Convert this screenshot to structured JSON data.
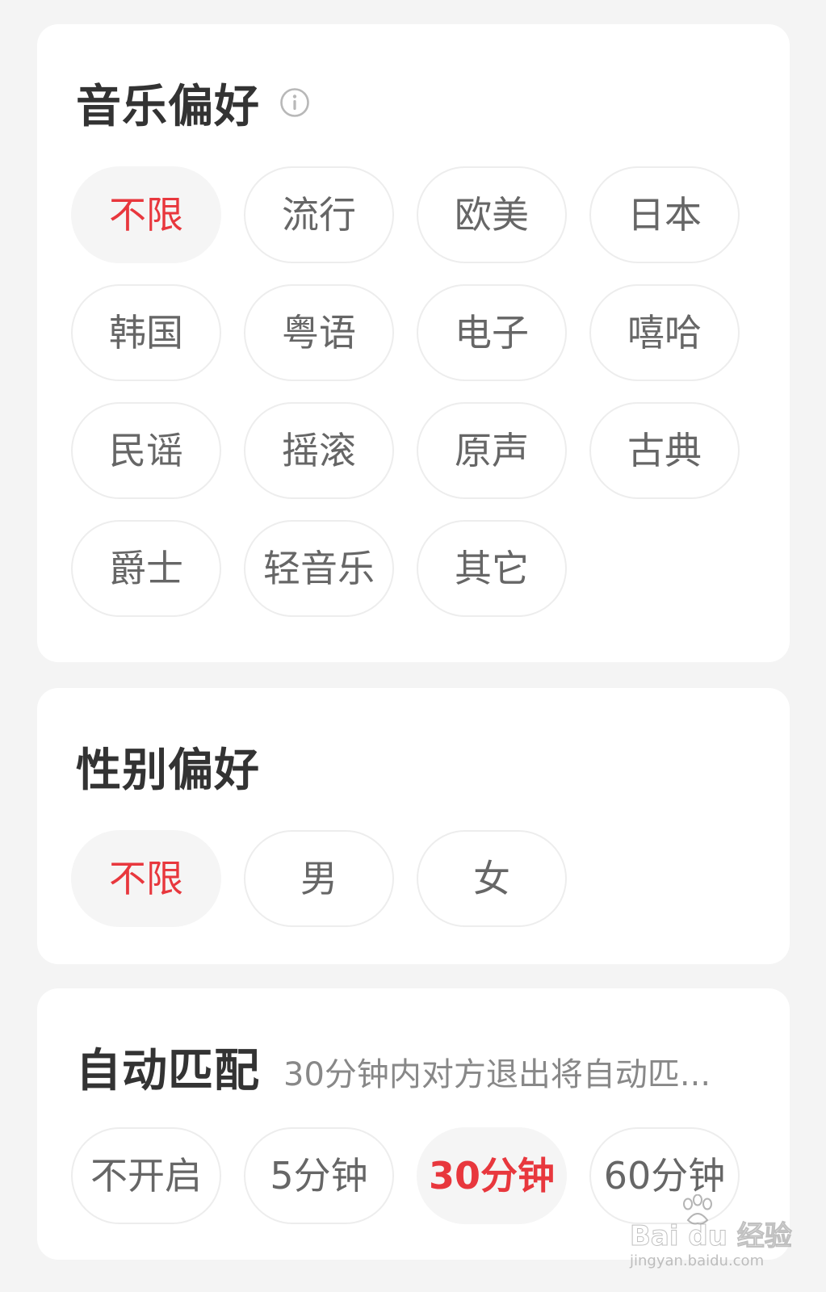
{
  "music": {
    "title": "音乐偏好",
    "info_icon": "info-circle-icon",
    "options": [
      {
        "label": "不限",
        "selected": true
      },
      {
        "label": "流行",
        "selected": false
      },
      {
        "label": "欧美",
        "selected": false
      },
      {
        "label": "日本",
        "selected": false
      },
      {
        "label": "韩国",
        "selected": false
      },
      {
        "label": "粤语",
        "selected": false
      },
      {
        "label": "电子",
        "selected": false
      },
      {
        "label": "嘻哈",
        "selected": false
      },
      {
        "label": "民谣",
        "selected": false
      },
      {
        "label": "摇滚",
        "selected": false
      },
      {
        "label": "原声",
        "selected": false
      },
      {
        "label": "古典",
        "selected": false
      },
      {
        "label": "爵士",
        "selected": false
      },
      {
        "label": "轻音乐",
        "selected": false
      },
      {
        "label": "其它",
        "selected": false
      }
    ]
  },
  "gender": {
    "title": "性别偏好",
    "options": [
      {
        "label": "不限",
        "selected": true
      },
      {
        "label": "男",
        "selected": false
      },
      {
        "label": "女",
        "selected": false
      }
    ]
  },
  "auto_match": {
    "title": "自动匹配",
    "subtitle": "30分钟内对方退出将自动匹...",
    "options": [
      {
        "label": "不开启",
        "selected": false
      },
      {
        "label": "5分钟",
        "selected": false
      },
      {
        "label": "30分钟",
        "selected": true
      },
      {
        "label": "60分钟",
        "selected": false
      }
    ]
  },
  "watermark": {
    "logo": "Bai du 经验",
    "url": "jingyan.baidu.com"
  },
  "colors": {
    "accent": "#e8373d",
    "chip_text": "#666666",
    "title_text": "#333333",
    "background": "#f4f4f4",
    "card": "#ffffff"
  }
}
